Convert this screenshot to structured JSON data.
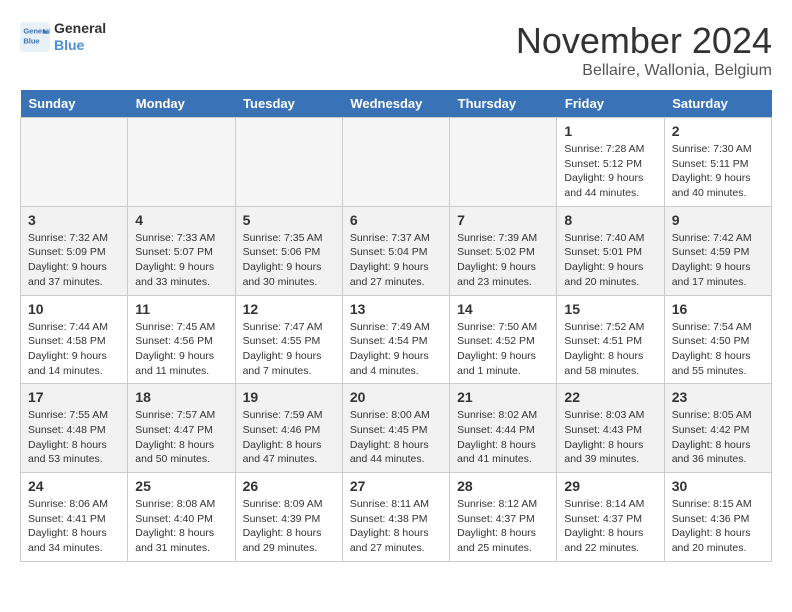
{
  "logo": {
    "line1": "General",
    "line2": "Blue"
  },
  "title": "November 2024",
  "location": "Bellaire, Wallonia, Belgium",
  "headers": [
    "Sunday",
    "Monday",
    "Tuesday",
    "Wednesday",
    "Thursday",
    "Friday",
    "Saturday"
  ],
  "weeks": [
    [
      {
        "day": "",
        "info": ""
      },
      {
        "day": "",
        "info": ""
      },
      {
        "day": "",
        "info": ""
      },
      {
        "day": "",
        "info": ""
      },
      {
        "day": "",
        "info": ""
      },
      {
        "day": "1",
        "info": "Sunrise: 7:28 AM\nSunset: 5:12 PM\nDaylight: 9 hours\nand 44 minutes."
      },
      {
        "day": "2",
        "info": "Sunrise: 7:30 AM\nSunset: 5:11 PM\nDaylight: 9 hours\nand 40 minutes."
      }
    ],
    [
      {
        "day": "3",
        "info": "Sunrise: 7:32 AM\nSunset: 5:09 PM\nDaylight: 9 hours\nand 37 minutes."
      },
      {
        "day": "4",
        "info": "Sunrise: 7:33 AM\nSunset: 5:07 PM\nDaylight: 9 hours\nand 33 minutes."
      },
      {
        "day": "5",
        "info": "Sunrise: 7:35 AM\nSunset: 5:06 PM\nDaylight: 9 hours\nand 30 minutes."
      },
      {
        "day": "6",
        "info": "Sunrise: 7:37 AM\nSunset: 5:04 PM\nDaylight: 9 hours\nand 27 minutes."
      },
      {
        "day": "7",
        "info": "Sunrise: 7:39 AM\nSunset: 5:02 PM\nDaylight: 9 hours\nand 23 minutes."
      },
      {
        "day": "8",
        "info": "Sunrise: 7:40 AM\nSunset: 5:01 PM\nDaylight: 9 hours\nand 20 minutes."
      },
      {
        "day": "9",
        "info": "Sunrise: 7:42 AM\nSunset: 4:59 PM\nDaylight: 9 hours\nand 17 minutes."
      }
    ],
    [
      {
        "day": "10",
        "info": "Sunrise: 7:44 AM\nSunset: 4:58 PM\nDaylight: 9 hours\nand 14 minutes."
      },
      {
        "day": "11",
        "info": "Sunrise: 7:45 AM\nSunset: 4:56 PM\nDaylight: 9 hours\nand 11 minutes."
      },
      {
        "day": "12",
        "info": "Sunrise: 7:47 AM\nSunset: 4:55 PM\nDaylight: 9 hours\nand 7 minutes."
      },
      {
        "day": "13",
        "info": "Sunrise: 7:49 AM\nSunset: 4:54 PM\nDaylight: 9 hours\nand 4 minutes."
      },
      {
        "day": "14",
        "info": "Sunrise: 7:50 AM\nSunset: 4:52 PM\nDaylight: 9 hours\nand 1 minute."
      },
      {
        "day": "15",
        "info": "Sunrise: 7:52 AM\nSunset: 4:51 PM\nDaylight: 8 hours\nand 58 minutes."
      },
      {
        "day": "16",
        "info": "Sunrise: 7:54 AM\nSunset: 4:50 PM\nDaylight: 8 hours\nand 55 minutes."
      }
    ],
    [
      {
        "day": "17",
        "info": "Sunrise: 7:55 AM\nSunset: 4:48 PM\nDaylight: 8 hours\nand 53 minutes."
      },
      {
        "day": "18",
        "info": "Sunrise: 7:57 AM\nSunset: 4:47 PM\nDaylight: 8 hours\nand 50 minutes."
      },
      {
        "day": "19",
        "info": "Sunrise: 7:59 AM\nSunset: 4:46 PM\nDaylight: 8 hours\nand 47 minutes."
      },
      {
        "day": "20",
        "info": "Sunrise: 8:00 AM\nSunset: 4:45 PM\nDaylight: 8 hours\nand 44 minutes."
      },
      {
        "day": "21",
        "info": "Sunrise: 8:02 AM\nSunset: 4:44 PM\nDaylight: 8 hours\nand 41 minutes."
      },
      {
        "day": "22",
        "info": "Sunrise: 8:03 AM\nSunset: 4:43 PM\nDaylight: 8 hours\nand 39 minutes."
      },
      {
        "day": "23",
        "info": "Sunrise: 8:05 AM\nSunset: 4:42 PM\nDaylight: 8 hours\nand 36 minutes."
      }
    ],
    [
      {
        "day": "24",
        "info": "Sunrise: 8:06 AM\nSunset: 4:41 PM\nDaylight: 8 hours\nand 34 minutes."
      },
      {
        "day": "25",
        "info": "Sunrise: 8:08 AM\nSunset: 4:40 PM\nDaylight: 8 hours\nand 31 minutes."
      },
      {
        "day": "26",
        "info": "Sunrise: 8:09 AM\nSunset: 4:39 PM\nDaylight: 8 hours\nand 29 minutes."
      },
      {
        "day": "27",
        "info": "Sunrise: 8:11 AM\nSunset: 4:38 PM\nDaylight: 8 hours\nand 27 minutes."
      },
      {
        "day": "28",
        "info": "Sunrise: 8:12 AM\nSunset: 4:37 PM\nDaylight: 8 hours\nand 25 minutes."
      },
      {
        "day": "29",
        "info": "Sunrise: 8:14 AM\nSunset: 4:37 PM\nDaylight: 8 hours\nand 22 minutes."
      },
      {
        "day": "30",
        "info": "Sunrise: 8:15 AM\nSunset: 4:36 PM\nDaylight: 8 hours\nand 20 minutes."
      }
    ]
  ]
}
